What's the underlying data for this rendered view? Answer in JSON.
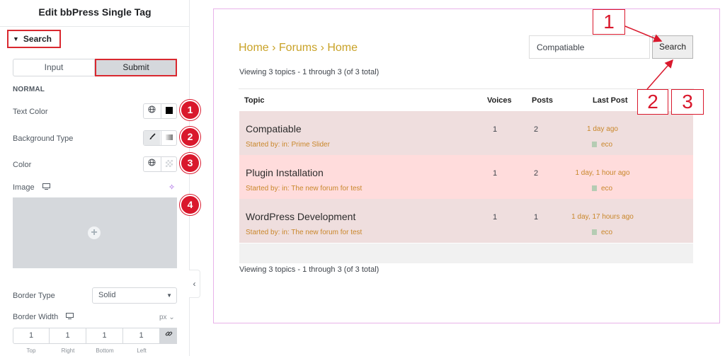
{
  "panel": {
    "title": "Edit bbPress Single Tag",
    "section_label": "Search",
    "tabs": {
      "input": "Input",
      "submit": "Submit"
    },
    "state_label": "NORMAL",
    "controls": {
      "text_color": "Text Color",
      "background_type": "Background Type",
      "color": "Color",
      "image": "Image",
      "border_type": "Border Type",
      "border_type_value": "Solid",
      "border_width": "Border Width",
      "unit": "px",
      "dimensions": [
        {
          "label": "Top",
          "value": "1"
        },
        {
          "label": "Right",
          "value": "1"
        },
        {
          "label": "Bottom",
          "value": "1"
        },
        {
          "label": "Left",
          "value": "1"
        }
      ]
    },
    "badges": [
      "1",
      "2",
      "3",
      "4"
    ]
  },
  "preview": {
    "breadcrumb": "Home › Forums › Home",
    "search_value": "Compatiable",
    "search_button": "Search",
    "viewing_text": "Viewing 3 topics - 1 through 3 (of 3 total)",
    "columns": {
      "topic": "Topic",
      "voices": "Voices",
      "posts": "Posts",
      "last_post": "Last Post"
    },
    "rows": [
      {
        "title": "Compatiable",
        "meta": "Started by: in: Prime Slider",
        "voices": "1",
        "posts": "2",
        "last_post": "1 day ago",
        "author": "eco",
        "bg": "#efdede"
      },
      {
        "title": "Plugin Installation",
        "meta": "Started by: in: The new forum for test",
        "voices": "1",
        "posts": "2",
        "last_post": "1 day, 1 hour ago",
        "author": "eco",
        "bg": "#ffdcdc"
      },
      {
        "title": "WordPress Development",
        "meta": "Started by: in: The new forum for test",
        "voices": "1",
        "posts": "1",
        "last_post": "1 day, 17 hours ago",
        "author": "eco",
        "bg": "#efdede"
      }
    ]
  },
  "annotations": {
    "box_1": "1",
    "box_2": "2",
    "box_3": "3"
  },
  "colors": {
    "accent_red": "#d9182c",
    "breadcrumb_gold": "#c9a227",
    "meta_orange": "#c9872b",
    "frame_border": "#e8b3e9"
  }
}
